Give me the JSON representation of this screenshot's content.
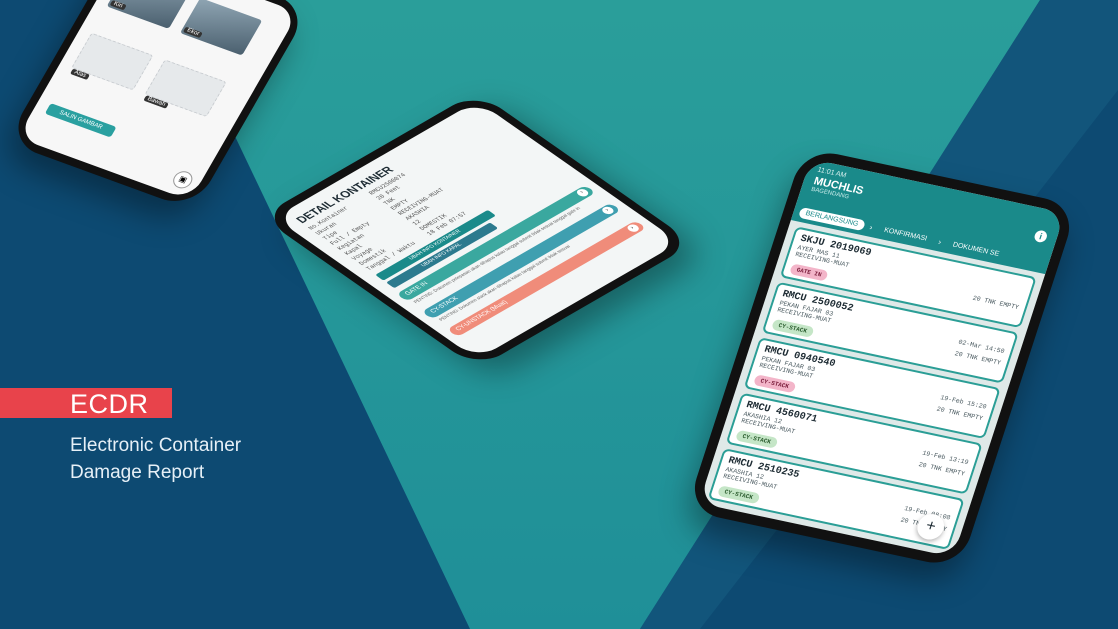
{
  "brand": {
    "tag": "ECDR",
    "subtitle_line1": "Electronic Container",
    "subtitle_line2": "Damage Report"
  },
  "colors": {
    "background": "#0d4a72",
    "teal": "#1a8a8a",
    "accent_red": "#e8434b"
  },
  "phone_list": {
    "status_time": "11:01 AM",
    "user": "MUCHLIS",
    "user_sub": "BAGENDANG",
    "tabs": [
      "BERLANGSUNG",
      "KONFIRMASI",
      "DOKUMEN SE"
    ],
    "cards": [
      {
        "container": "SKJU 2019069",
        "vessel": "AYER MAS  11",
        "type": "RECEIVING-MUAT",
        "date": "",
        "cont": "20 TNK EMPTY",
        "status": "GATE IN",
        "status_color": "pink"
      },
      {
        "container": "RMCU 2500052",
        "vessel": "PEKAN FAJAR  03",
        "type": "RECEIVING-MUAT",
        "date": "02-Mar 14:50",
        "cont": "20 TNK EMPTY",
        "status": "CY-STACK",
        "status_color": "green"
      },
      {
        "container": "RMCU 0940540",
        "vessel": "PEKAN FAJAR  03",
        "type": "RECEIVING-MUAT",
        "date": "19-Feb 15:20",
        "cont": "20 TNK EMPTY",
        "status": "CY-STACK",
        "status_color": "pink"
      },
      {
        "container": "RMCU 4560071",
        "vessel": "AKASHIA  12",
        "type": "RECEIVING-MUAT",
        "date": "19-Feb 13:19",
        "cont": "20 TNK EMPTY",
        "status": "CY-STACK",
        "status_color": "green"
      },
      {
        "container": "RMCU 2510235",
        "vessel": "AKASHIA  12",
        "type": "RECEIVING-MUAT",
        "date": "19-Feb 08:08",
        "cont": "20 TNK EMPTY",
        "status": "CY-STACK",
        "status_color": "green"
      }
    ],
    "last_date": "18-Feb",
    "fab": "+"
  },
  "phone_detail": {
    "title": "DETAIL KONTAINER",
    "rows": [
      {
        "k": "No.Kontainer",
        "v": "RMCU2500074"
      },
      {
        "k": "Ukuran",
        "v": "20 Feet"
      },
      {
        "k": "Tipe",
        "v": "TNK"
      },
      {
        "k": "Full / Empty",
        "v": "EMPTY"
      },
      {
        "k": "Kegiatan",
        "v": "RECEIVING-MUAT"
      },
      {
        "k": "Kapal",
        "v": "AKASHIA"
      },
      {
        "k": "Voyage",
        "v": "12"
      },
      {
        "k": "Domestik",
        "v": "DOMESTIK"
      },
      {
        "k": "Tanggal / Waktu",
        "v": "18 Feb 07:57"
      }
    ],
    "btn_info_kontainer": "UBAH INFO KONTAINER",
    "btn_info_kapal": "UBAH INFO KAPAL",
    "sections": [
      {
        "label": "GATE IN",
        "color": "#3aa89f",
        "note": "PENTING: Dokumen pelepasan akan dihapus kalau tanggal submit tidak sesuai tanggal gate in"
      },
      {
        "label": "CY-STACK",
        "color": "#3f9fb0",
        "note": "PENTING: Dokumen stack akan dihapus kalau tanggal submit tidak sesuai"
      },
      {
        "label": "CY-UNSTACK (Muat)",
        "color": "#f08c7a",
        "note": ""
      }
    ]
  },
  "phone_photos": {
    "labels": [
      "Kiri",
      "Ekor",
      "Atas",
      "Bawah"
    ],
    "save_button": "SALIN GAMBAR"
  }
}
